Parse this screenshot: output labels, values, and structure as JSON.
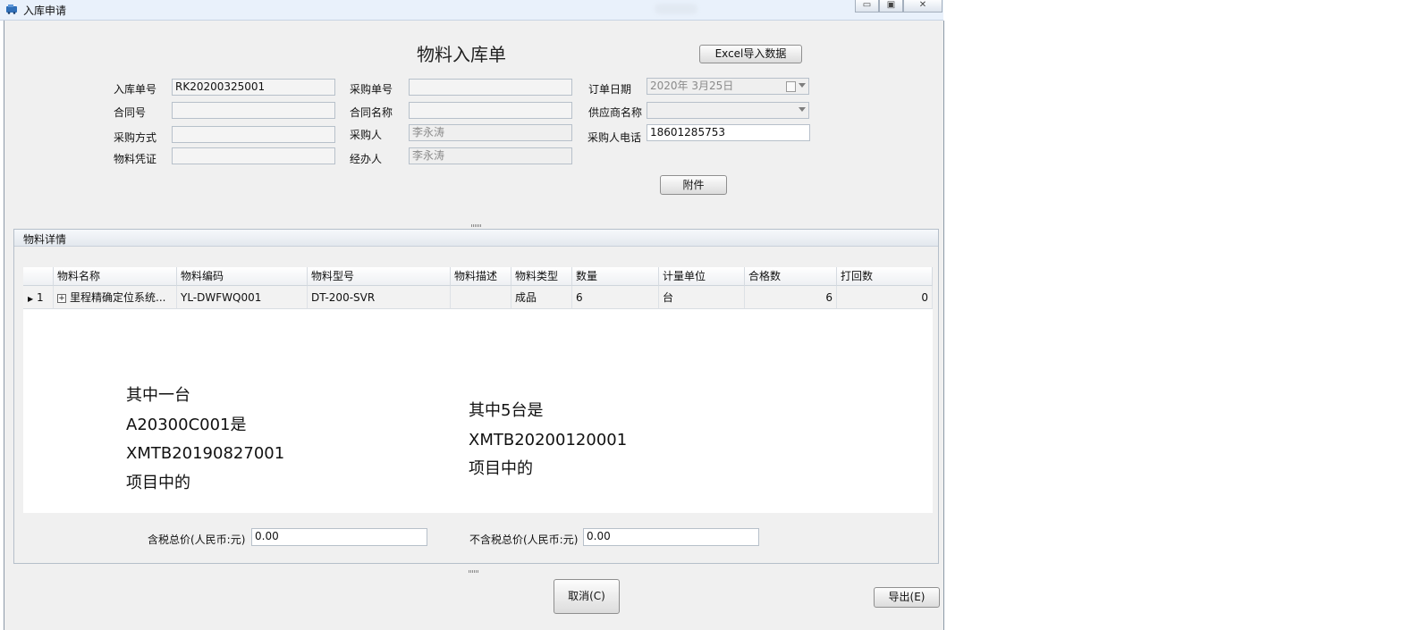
{
  "window": {
    "title": "入库申请",
    "buttons": {
      "minimize": "▭",
      "maximize": "▣",
      "close": "✕"
    }
  },
  "form": {
    "title": "物料入库单",
    "excel_import_label": "Excel导入数据",
    "attachment_label": "附件",
    "fields": {
      "receipt_no": {
        "label": "入库单号",
        "value": "RK20200325001"
      },
      "purchase_no": {
        "label": "采购单号",
        "value": ""
      },
      "order_date": {
        "label": "订单日期",
        "value": "2020年  3月25日"
      },
      "contract_no": {
        "label": "合同号",
        "value": ""
      },
      "contract_name": {
        "label": "合同名称",
        "value": ""
      },
      "supplier_name": {
        "label": "供应商名称",
        "value": ""
      },
      "purchase_method": {
        "label": "采购方式",
        "value": ""
      },
      "purchaser": {
        "label": "采购人",
        "value": "李永涛"
      },
      "purchaser_phone": {
        "label": "采购人电话",
        "value": "18601285753"
      },
      "material_voucher": {
        "label": "物料凭证",
        "value": ""
      },
      "handler": {
        "label": "经办人",
        "value": "李永涛"
      }
    }
  },
  "details": {
    "group_title": "物料详情",
    "columns": [
      "物料名称",
      "物料编码",
      "物料型号",
      "物料描述",
      "物料类型",
      "数量",
      "计量单位",
      "合格数",
      "打回数"
    ],
    "rows": [
      {
        "index": "1",
        "expander": "+",
        "name": "里程精确定位系统...",
        "code": "YL-DWFWQ001",
        "model": "DT-200-SVR",
        "description": "",
        "type": "成品",
        "quantity": "6",
        "unit": "台",
        "qualified": "6",
        "returned": "0"
      }
    ],
    "note_left": [
      "其中一台",
      "A20300C001是",
      "XMTB20190827001",
      "项目中的"
    ],
    "note_right": [
      "其中5台是",
      "XMTB20200120001",
      "项目中的"
    ],
    "total_with_tax": {
      "label": "含税总价(人民币:元)",
      "value": "0.00"
    },
    "total_without_tax": {
      "label": "不含税总价(人民币:元)",
      "value": "0.00"
    }
  },
  "footer": {
    "cancel_label": "取消(C)",
    "export_label": "导出(E)"
  }
}
